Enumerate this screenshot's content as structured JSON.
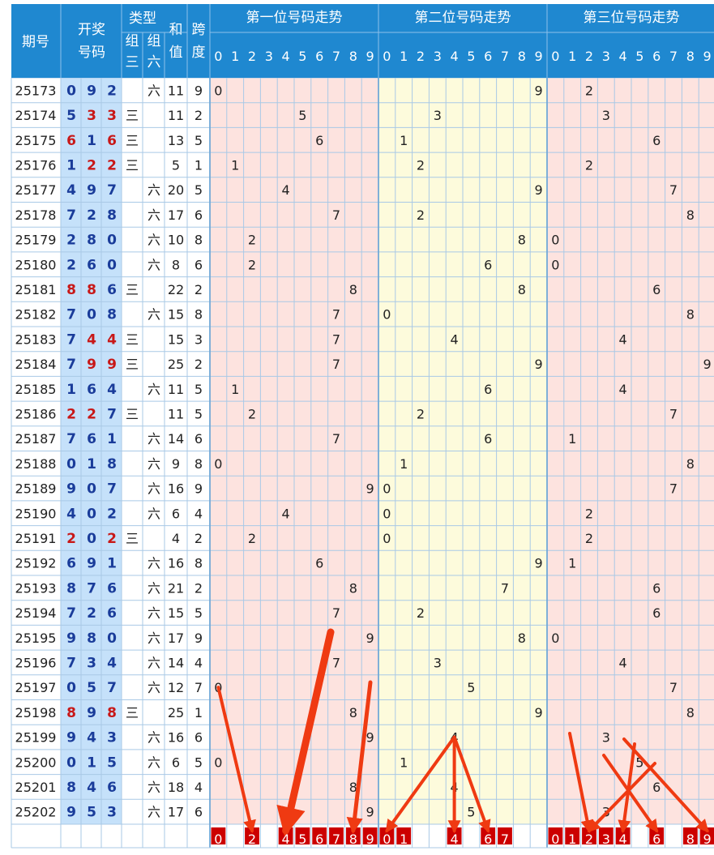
{
  "header": {
    "period": "期号",
    "draw_numbers": [
      "开奖",
      "号码"
    ],
    "type": "类型",
    "group3": [
      "组",
      "三"
    ],
    "group6": [
      "组",
      "六"
    ],
    "sum": [
      "和",
      "值"
    ],
    "span": [
      "跨",
      "度"
    ],
    "pos1_title": "第一位号码走势",
    "pos2_title": "第二位号码走势",
    "pos3_title": "第三位号码走势",
    "digits": [
      "0",
      "1",
      "2",
      "3",
      "4",
      "5",
      "6",
      "7",
      "8",
      "9"
    ]
  },
  "labels": {
    "group3_mark": "三",
    "group6_mark": "六"
  },
  "chart_data": {
    "type": "table",
    "columns": [
      "期号",
      "开奖号码",
      "组三",
      "组六",
      "和值",
      "跨度"
    ],
    "rows": [
      {
        "period": "25173",
        "nums": [
          0,
          9,
          2
        ],
        "type": "六",
        "sum": 11,
        "span": 9
      },
      {
        "period": "25174",
        "nums": [
          5,
          3,
          3
        ],
        "type": "三",
        "sum": 11,
        "span": 2
      },
      {
        "period": "25175",
        "nums": [
          6,
          1,
          6
        ],
        "type": "三",
        "sum": 13,
        "span": 5
      },
      {
        "period": "25176",
        "nums": [
          1,
          2,
          2
        ],
        "type": "三",
        "sum": 5,
        "span": 1
      },
      {
        "period": "25177",
        "nums": [
          4,
          9,
          7
        ],
        "type": "六",
        "sum": 20,
        "span": 5
      },
      {
        "period": "25178",
        "nums": [
          7,
          2,
          8
        ],
        "type": "六",
        "sum": 17,
        "span": 6
      },
      {
        "period": "25179",
        "nums": [
          2,
          8,
          0
        ],
        "type": "六",
        "sum": 10,
        "span": 8
      },
      {
        "period": "25180",
        "nums": [
          2,
          6,
          0
        ],
        "type": "六",
        "sum": 8,
        "span": 6
      },
      {
        "period": "25181",
        "nums": [
          8,
          8,
          6
        ],
        "type": "三",
        "sum": 22,
        "span": 2
      },
      {
        "period": "25182",
        "nums": [
          7,
          0,
          8
        ],
        "type": "六",
        "sum": 15,
        "span": 8
      },
      {
        "period": "25183",
        "nums": [
          7,
          4,
          4
        ],
        "type": "三",
        "sum": 15,
        "span": 3
      },
      {
        "period": "25184",
        "nums": [
          7,
          9,
          9
        ],
        "type": "三",
        "sum": 25,
        "span": 2
      },
      {
        "period": "25185",
        "nums": [
          1,
          6,
          4
        ],
        "type": "六",
        "sum": 11,
        "span": 5
      },
      {
        "period": "25186",
        "nums": [
          2,
          2,
          7
        ],
        "type": "三",
        "sum": 11,
        "span": 5
      },
      {
        "period": "25187",
        "nums": [
          7,
          6,
          1
        ],
        "type": "六",
        "sum": 14,
        "span": 6
      },
      {
        "period": "25188",
        "nums": [
          0,
          1,
          8
        ],
        "type": "六",
        "sum": 9,
        "span": 8
      },
      {
        "period": "25189",
        "nums": [
          9,
          0,
          7
        ],
        "type": "六",
        "sum": 16,
        "span": 9
      },
      {
        "period": "25190",
        "nums": [
          4,
          0,
          2
        ],
        "type": "六",
        "sum": 6,
        "span": 4
      },
      {
        "period": "25191",
        "nums": [
          2,
          0,
          2
        ],
        "type": "三",
        "sum": 4,
        "span": 2
      },
      {
        "period": "25192",
        "nums": [
          6,
          9,
          1
        ],
        "type": "六",
        "sum": 16,
        "span": 8
      },
      {
        "period": "25193",
        "nums": [
          8,
          7,
          6
        ],
        "type": "六",
        "sum": 21,
        "span": 2
      },
      {
        "period": "25194",
        "nums": [
          7,
          2,
          6
        ],
        "type": "六",
        "sum": 15,
        "span": 5
      },
      {
        "period": "25195",
        "nums": [
          9,
          8,
          0
        ],
        "type": "六",
        "sum": 17,
        "span": 9
      },
      {
        "period": "25196",
        "nums": [
          7,
          3,
          4
        ],
        "type": "六",
        "sum": 14,
        "span": 4
      },
      {
        "period": "25197",
        "nums": [
          0,
          5,
          7
        ],
        "type": "六",
        "sum": 12,
        "span": 7
      },
      {
        "period": "25198",
        "nums": [
          8,
          9,
          8
        ],
        "type": "三",
        "sum": 25,
        "span": 1
      },
      {
        "period": "25199",
        "nums": [
          9,
          4,
          3
        ],
        "type": "六",
        "sum": 16,
        "span": 6
      },
      {
        "period": "25200",
        "nums": [
          0,
          1,
          5
        ],
        "type": "六",
        "sum": 6,
        "span": 5
      },
      {
        "period": "25201",
        "nums": [
          8,
          4,
          6
        ],
        "type": "六",
        "sum": 18,
        "span": 4
      },
      {
        "period": "25202",
        "nums": [
          9,
          5,
          3
        ],
        "type": "六",
        "sum": 17,
        "span": 6
      }
    ],
    "selections": {
      "pos1": [
        0,
        2,
        4,
        5,
        6,
        7,
        8,
        9
      ],
      "pos2": [
        0,
        1,
        4,
        6,
        7
      ],
      "pos3": [
        0,
        1,
        2,
        3,
        4,
        6,
        8,
        9
      ]
    },
    "annotation": "red arrows point from recent draws toward the selected digits"
  },
  "colors": {
    "header_bg": "#1f88d0",
    "period_bg": "#ffffff",
    "nums_bg": "#c5e1fa",
    "type_bg": "#ffffff",
    "pos1_bg": "#fde3df",
    "pos2_bg": "#fdfbdc",
    "pos3_bg": "#fde3df",
    "grid": "#a9c9e6",
    "num_blue": "#1a3c9a",
    "num_red": "#c81818",
    "select_bg": "#cc0000",
    "arrow": "#ef3a12"
  }
}
